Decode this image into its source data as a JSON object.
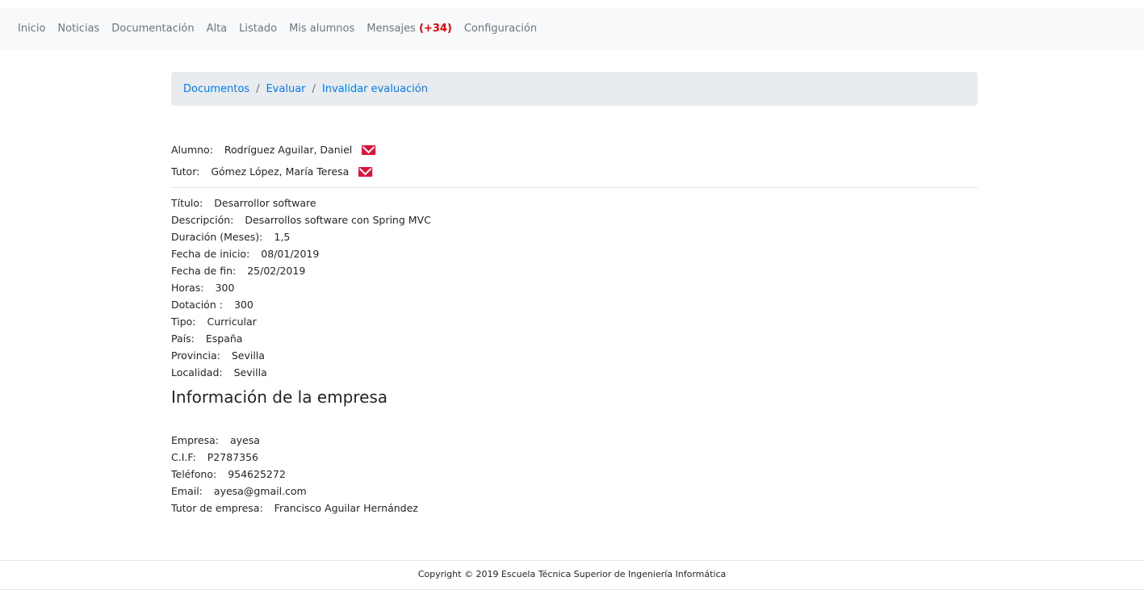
{
  "nav": {
    "items": [
      "Inicio",
      "Noticias",
      "Documentación",
      "Alta",
      "Listado",
      "Mis alumnos"
    ],
    "messages_label": "Mensajes",
    "messages_badge": "(+34)",
    "config": "Configuración"
  },
  "breadcrumb": [
    "Documentos",
    "Evaluar",
    "Invalidar evaluación"
  ],
  "people": [
    {
      "label": "Alumno:",
      "value": "Rodríguez Aguilar, Daniel",
      "icon": "envelope-icon"
    },
    {
      "label": "Tutor:",
      "value": "Gómez López, María Teresa",
      "icon": "envelope-icon"
    }
  ],
  "details": [
    {
      "label": "Título:",
      "value": "Desarrollor software"
    },
    {
      "label": "Descripción:",
      "value": "Desarrollos software con Spring MVC"
    },
    {
      "label": "Duración (Meses):",
      "value": "1,5"
    },
    {
      "label": "Fecha de inicio:",
      "value": "08/01/2019"
    },
    {
      "label": "Fecha de fin:",
      "value": "25/02/2019"
    },
    {
      "label": "Horas:",
      "value": "300"
    },
    {
      "label": "Dotación :",
      "value": "300"
    },
    {
      "label": "Tipo:",
      "value": "Curricular"
    },
    {
      "label": "País:",
      "value": "España"
    },
    {
      "label": "Provincia:",
      "value": "Sevilla"
    },
    {
      "label": "Localidad:",
      "value": "Sevilla"
    }
  ],
  "company": {
    "heading": "Información de la empresa",
    "rows": [
      {
        "label": "Empresa:",
        "value": "ayesa"
      },
      {
        "label": "C.I.F:",
        "value": "P2787356"
      },
      {
        "label": "Teléfono:",
        "value": "954625272"
      },
      {
        "label": "Email:",
        "value": "ayesa@gmail.com"
      },
      {
        "label": "Tutor de empresa:",
        "value": "Francisco Aguilar Hernández"
      }
    ]
  },
  "footer": "Copyright © 2019 Escuela Técnica Superior de Ingeniería Informática",
  "colors": {
    "accent": "#007bff",
    "mail": "#dc143c",
    "badge": "#ee0000"
  }
}
